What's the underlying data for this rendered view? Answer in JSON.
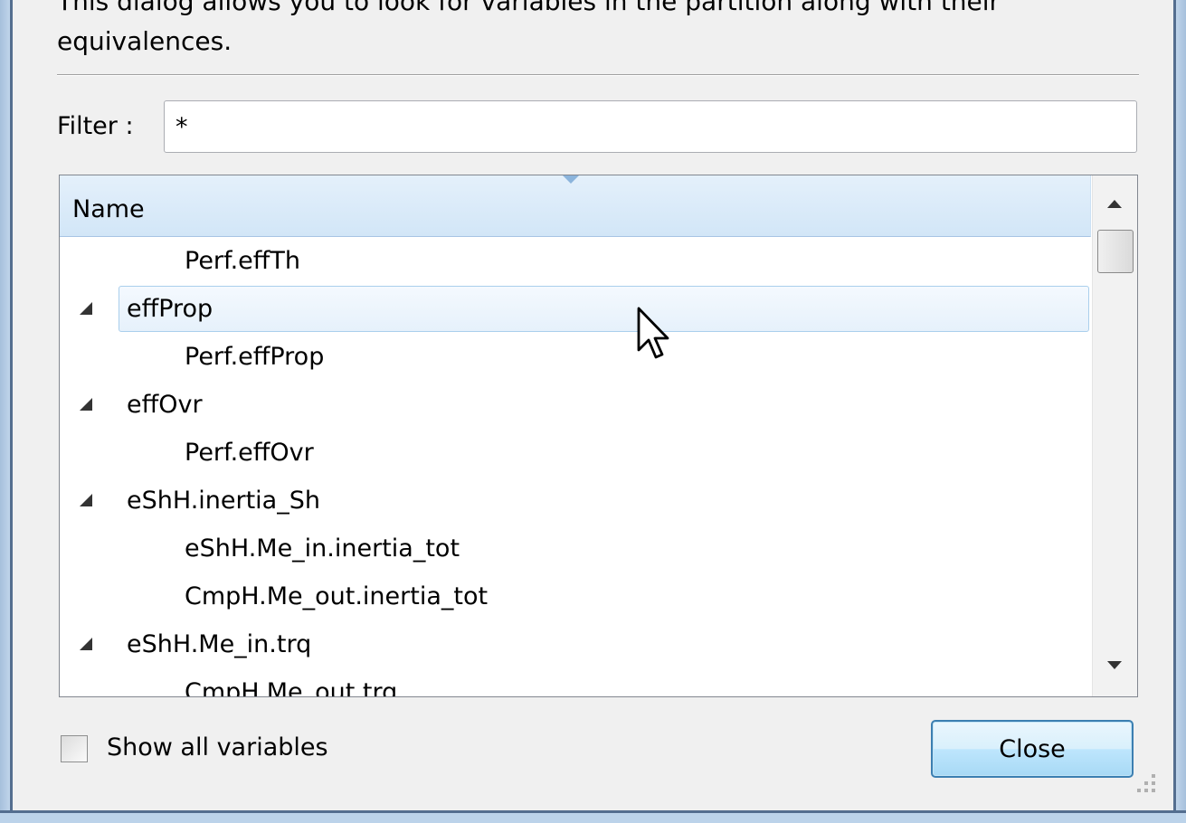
{
  "dialog": {
    "description": "This dialog allows you to look for variables in the partition along with their equivalences.",
    "filter_label": "Filter :",
    "filter_value": "*",
    "column_header": "Name",
    "rows": [
      {
        "label": "Perf.effTh",
        "level": 1
      },
      {
        "label": "effProp",
        "level": 0,
        "selected": true
      },
      {
        "label": "Perf.effProp",
        "level": 1
      },
      {
        "label": "effOvr",
        "level": 0
      },
      {
        "label": "Perf.effOvr",
        "level": 1
      },
      {
        "label": "eShH.inertia_Sh",
        "level": 0
      },
      {
        "label": "eShH.Me_in.inertia_tot",
        "level": 1
      },
      {
        "label": "CmpH.Me_out.inertia_tot",
        "level": 1
      },
      {
        "label": "eShH.Me_in.trq",
        "level": 0
      },
      {
        "label": "CmpH.Me_out.trq",
        "level": 1
      }
    ],
    "show_all_label": "Show all variables",
    "show_all_checked": false,
    "close_label": "Close"
  },
  "icons": {
    "expander": "expanded-triangle-icon",
    "sort": "sort-descending-icon",
    "scroll_up": "scroll-up-arrow-icon",
    "scroll_down": "scroll-down-arrow-icon",
    "cursor": "mouse-pointer-icon",
    "grip": "resize-grip-icon"
  }
}
